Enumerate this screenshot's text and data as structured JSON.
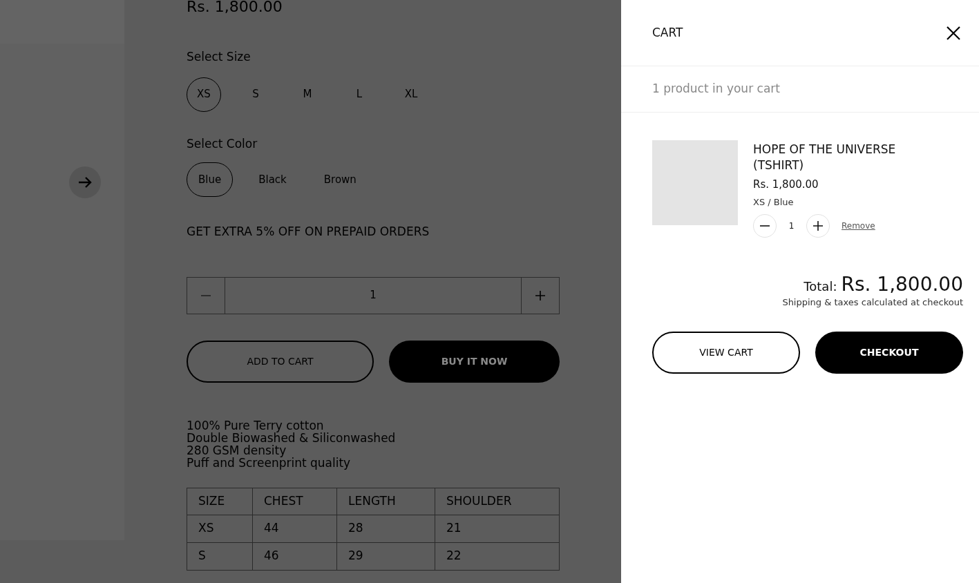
{
  "page": {
    "price": "Rs. 1,800.00",
    "size_label": "Select Size",
    "sizes": [
      {
        "label": "XS",
        "selected": true
      },
      {
        "label": "S",
        "selected": false
      },
      {
        "label": "M",
        "selected": false
      },
      {
        "label": "L",
        "selected": false
      },
      {
        "label": "XL",
        "selected": false
      }
    ],
    "color_label": "Select Color",
    "colors": [
      {
        "label": "Blue",
        "selected": true
      },
      {
        "label": "Black",
        "selected": false
      },
      {
        "label": "Brown",
        "selected": false
      }
    ],
    "promo": "GET EXTRA 5% OFF ON PREPAID ORDERS",
    "quantity": "1",
    "add_to_cart": "ADD TO CART",
    "buy_now": "BUY IT NOW",
    "description": [
      "100% Pure Terry cotton",
      "Double Biowashed & Siliconwashed",
      "280 GSM density",
      "Puff and Screenprint quality"
    ],
    "size_chart": {
      "columns": [
        "SIZE",
        "CHEST",
        "LENGTH",
        "SHOULDER"
      ],
      "rows": [
        [
          "XS",
          "44",
          "28",
          "21"
        ],
        [
          "S",
          "46",
          "29",
          "22"
        ]
      ]
    }
  },
  "cart": {
    "title": "CART",
    "count": "1 product in your cart",
    "items": [
      {
        "name": "HOPE OF THE UNIVERSE (TSHIRT)",
        "price": "Rs. 1,800.00",
        "variant": "XS / Blue",
        "quantity": "1",
        "remove": "Remove"
      }
    ],
    "total_label": "Total:",
    "total": "Rs. 1,800.00",
    "note": "Shipping & taxes calculated at checkout",
    "buttons": [
      {
        "label": "VIEW CART",
        "kind": "outline"
      },
      {
        "label": "CHECKOUT",
        "kind": "filled"
      }
    ]
  }
}
